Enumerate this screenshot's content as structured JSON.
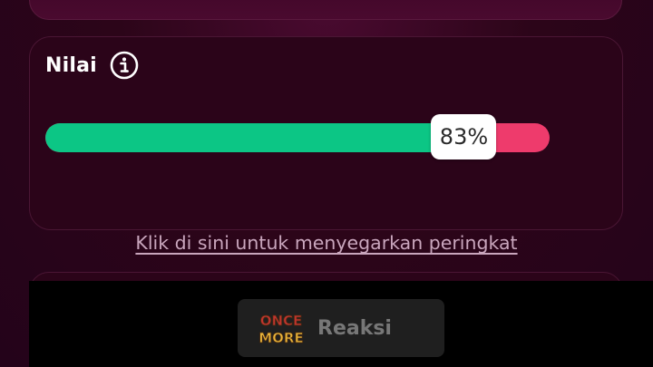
{
  "score_card": {
    "title": "Nilai",
    "progress_percent": 83,
    "progress_label": "83%",
    "colors": {
      "fill": "#0cc685",
      "remainder": "#ee3b6c"
    }
  },
  "refresh_link": "Klik di sini untuk menyegarkan peringkat",
  "bottom_bar": {
    "react_button_label": "Reaksi",
    "logo_text": [
      "ONCE",
      "MORE"
    ]
  },
  "icons": {
    "info": "info-icon",
    "logo": "once-more-logo"
  }
}
